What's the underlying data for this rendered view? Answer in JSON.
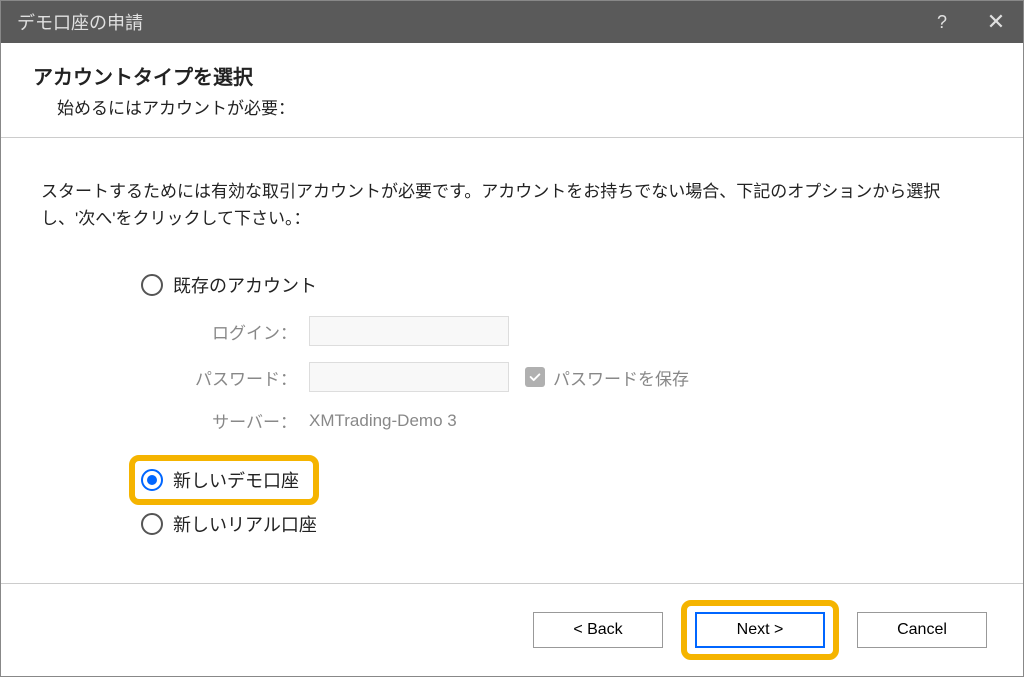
{
  "titlebar": {
    "title": "デモ口座の申請"
  },
  "header": {
    "title": "アカウントタイプを選択",
    "subtitle": "始めるにはアカウントが必要："
  },
  "content": {
    "instruction": "スタートするためには有効な取引アカウントが必要です。アカウントをお持ちでない場合、下記のオプションから選択し、'次へ'をクリックして下さい。："
  },
  "options": {
    "existing": {
      "label": "既存のアカウント",
      "selected": false,
      "login_label": "ログイン：",
      "login_value": "",
      "password_label": "パスワード：",
      "password_value": "",
      "save_password_label": "パスワードを保存",
      "server_label": "サーバー：",
      "server_value": "XMTrading-Demo 3"
    },
    "new_demo": {
      "label": "新しいデモ口座",
      "selected": true
    },
    "new_real": {
      "label": "新しいリアル口座",
      "selected": false
    }
  },
  "footer": {
    "back": "< Back",
    "next": "Next >",
    "cancel": "Cancel"
  }
}
